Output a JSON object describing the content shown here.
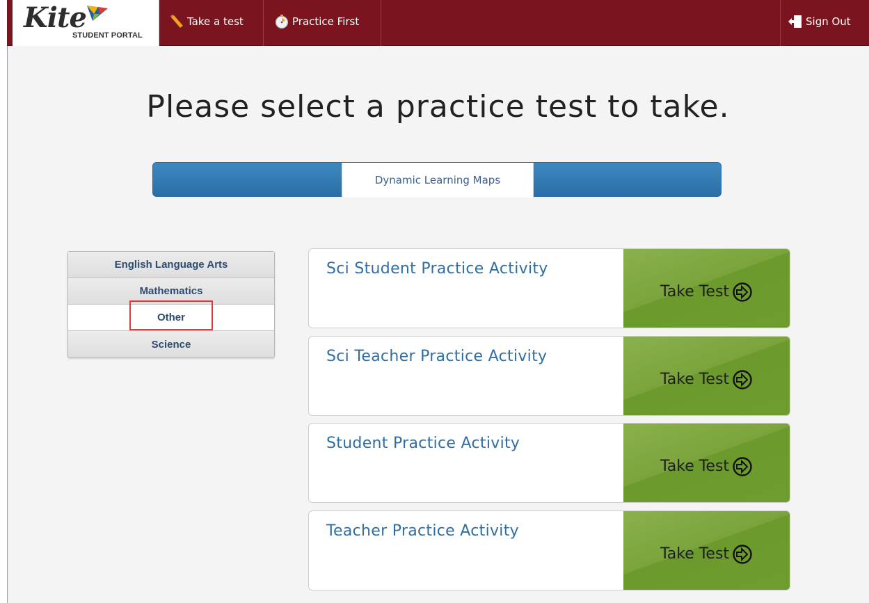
{
  "brand": {
    "logo_word": "Kite",
    "logo_sub": "STUDENT PORTAL"
  },
  "nav": {
    "take_test": "Take a test",
    "practice_first": "Practice First",
    "sign_out": "Sign Out",
    "take_test_icon": "pencil-icon",
    "practice_first_icon": "stopwatch-icon",
    "sign_out_icon": "exit-door-icon"
  },
  "page": {
    "heading": "Please select a practice test to take."
  },
  "program_tabs": {
    "active": "Dynamic Learning Maps"
  },
  "subjects": [
    {
      "label": "English Language Arts",
      "selected": false
    },
    {
      "label": "Mathematics",
      "selected": false
    },
    {
      "label": "Other",
      "selected": true
    },
    {
      "label": "Science",
      "selected": false
    }
  ],
  "tests": [
    {
      "title": "Sci Student Practice Activity",
      "button": "Take Test"
    },
    {
      "title": "Sci Teacher Practice Activity",
      "button": "Take Test"
    },
    {
      "title": "Student Practice Activity",
      "button": "Take Test"
    },
    {
      "title": "Teacher Practice Activity",
      "button": "Take Test"
    }
  ],
  "colors": {
    "navbar": "#7a1520",
    "tab_blue": "#2b6ea6",
    "button_green": "#7ba43d",
    "link_blue": "#2f6ea5",
    "highlight_red": "#e0393e"
  }
}
